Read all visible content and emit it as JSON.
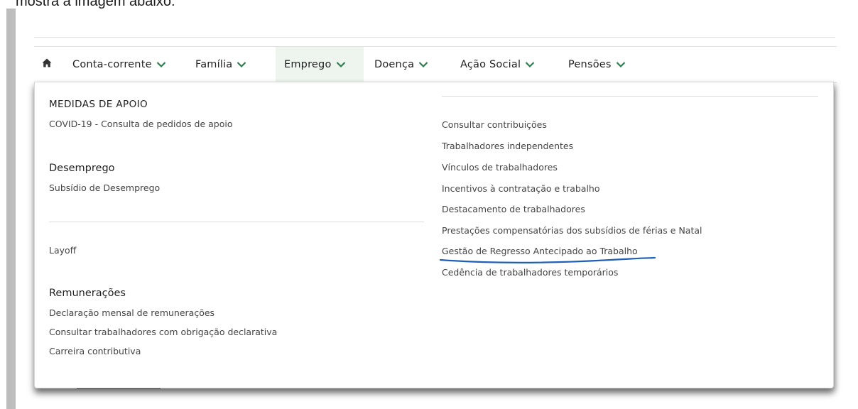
{
  "intro_text": "mostra a imagem abaixo:",
  "nav": {
    "items": [
      {
        "label": "Conta-corrente"
      },
      {
        "label": "Família"
      },
      {
        "label": "Emprego"
      },
      {
        "label": "Doença"
      },
      {
        "label": "Ação Social"
      },
      {
        "label": "Pensões"
      }
    ],
    "active": "Emprego",
    "accent_color": "#2e7d4f"
  },
  "menu": {
    "left": {
      "medidas": {
        "title": "MEDIDAS DE APOIO",
        "links": [
          "COVID-19 - Consulta de pedidos de apoio"
        ]
      },
      "desemprego": {
        "title": "Desemprego",
        "links": [
          "Subsídio de Desemprego"
        ]
      },
      "layoff": "Layoff",
      "remuneracoes": {
        "title": "Remunerações",
        "links": [
          "Declaração mensal de remunerações",
          "Consultar trabalhadores com obrigação declarativa",
          "Carreira contributiva"
        ]
      }
    },
    "right": {
      "links": [
        "Consultar contribuições",
        "Trabalhadores independentes",
        "Vínculos de trabalhadores",
        "Incentivos à contratação e trabalho",
        "Destacamento de trabalhadores",
        "Prestações compensatórias dos subsídios de férias e Natal",
        "Gestão de Regresso Antecipado ao Trabalho",
        "Cedência de trabalhadores temporários"
      ],
      "highlighted": "Gestão de Regresso Antecipado ao Trabalho",
      "annotation_color": "#1f5fb5"
    }
  }
}
